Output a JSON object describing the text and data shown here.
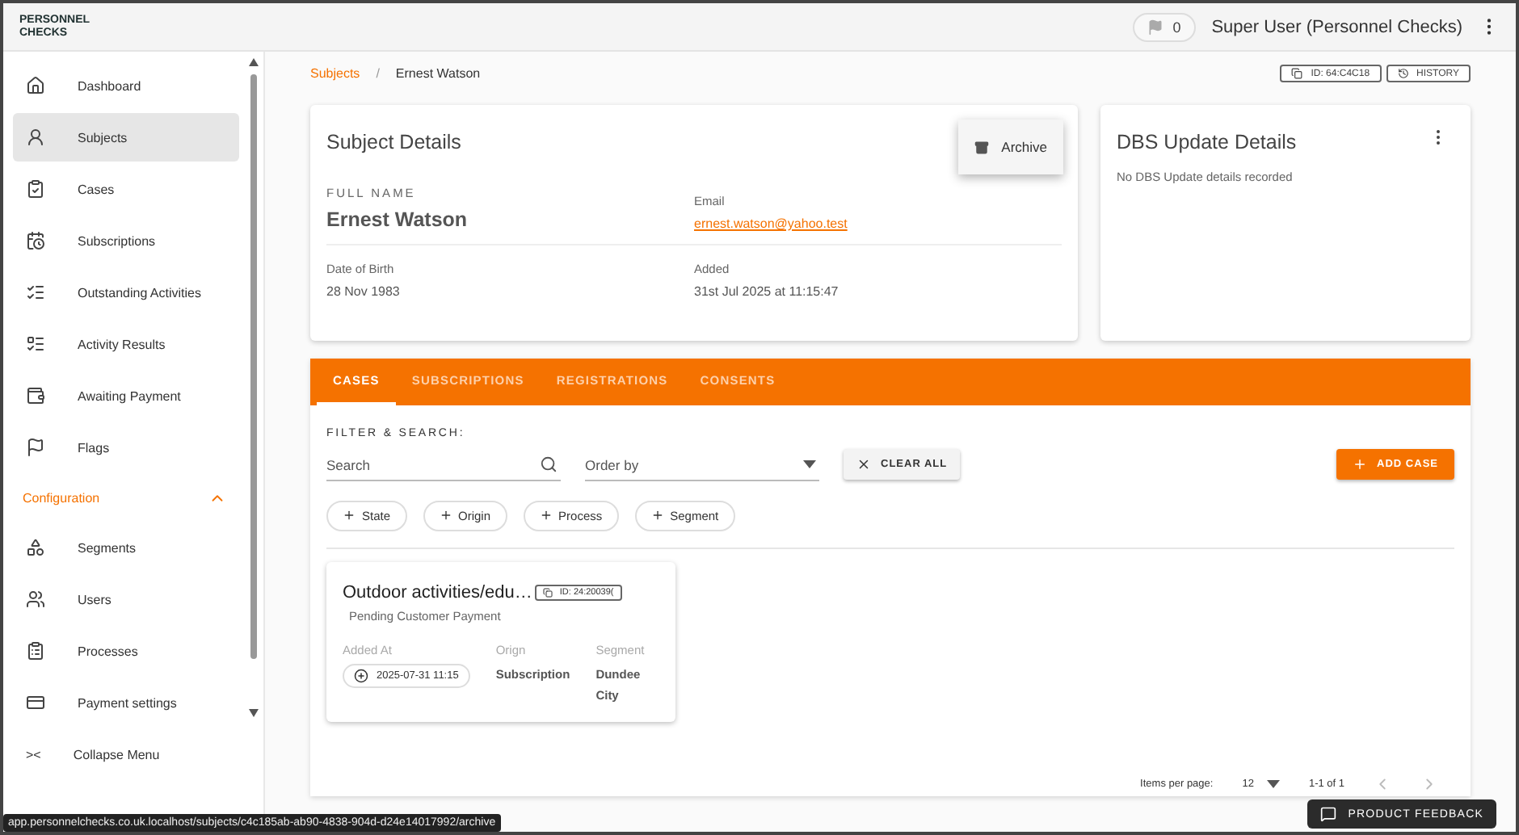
{
  "header": {
    "logo": [
      "PERSONNEL",
      "CHECKS"
    ],
    "flag_count": "0",
    "user": "Super User (Personnel Checks)"
  },
  "sidebar": {
    "items": [
      {
        "label": "Dashboard",
        "selected": false
      },
      {
        "label": "Subjects",
        "selected": true
      },
      {
        "label": "Cases",
        "selected": false
      },
      {
        "label": "Subscriptions",
        "selected": false
      },
      {
        "label": "Outstanding Activities",
        "selected": false
      },
      {
        "label": "Activity Results",
        "selected": false
      },
      {
        "label": "Awaiting Payment",
        "selected": false
      },
      {
        "label": "Flags",
        "selected": false
      }
    ],
    "section": {
      "label": "Configuration",
      "expanded": true
    },
    "config_items": [
      {
        "label": "Segments",
        "selected": false
      },
      {
        "label": "Users",
        "selected": false
      },
      {
        "label": "Processes",
        "selected": false
      },
      {
        "label": "Payment settings",
        "selected": false
      }
    ],
    "collapse": {
      "icon": "><",
      "label": "Collapse Menu"
    }
  },
  "breadcrumb": {
    "items": [
      "Subjects",
      "Ernest Watson"
    ],
    "separator": "/"
  },
  "top_actions": [
    {
      "label": "ID: 64:C4C18"
    },
    {
      "label": "HISTORY"
    }
  ],
  "subject_details": {
    "title": "Subject Details",
    "menu": [
      {
        "label": "Archive"
      }
    ],
    "fields": [
      {
        "label": "FULL NAME",
        "value": "Ernest Watson",
        "kind": "name"
      },
      {
        "label": "Email",
        "value": "ernest.watson@yahoo.test",
        "kind": "link"
      },
      {
        "label": "Date of Birth",
        "value": "28 Nov 1983",
        "kind": "plain"
      },
      {
        "label": "Added",
        "value": "31st Jul 2025 at 11:15:47",
        "kind": "plain"
      }
    ]
  },
  "dbs": {
    "title": "DBS Update Details",
    "message": "No DBS Update details recorded"
  },
  "tabs": [
    {
      "label": "CASES",
      "selected": true
    },
    {
      "label": "SUBSCRIPTIONS",
      "selected": false
    },
    {
      "label": "REGISTRATIONS",
      "selected": false
    },
    {
      "label": "CONSENTS",
      "selected": false
    }
  ],
  "filter": {
    "title": "FILTER & SEARCH:",
    "search": {
      "placeholder": "Search"
    },
    "order": {
      "placeholder": "Order by"
    },
    "clear": "CLEAR ALL",
    "add": "ADD CASE",
    "chips": [
      "State",
      "Origin",
      "Process",
      "Segment"
    ]
  },
  "cases": [
    {
      "title": "Outdoor activities/edu…",
      "id": "ID: 24:20039(",
      "status": "Pending Customer Payment",
      "added_label": "Added At",
      "added": "2025-07-31 11:15",
      "origin_label": "Orign",
      "origin": "Subscription",
      "segment_label": "Segment",
      "segment": "Dundee City"
    }
  ],
  "pagination": {
    "label": "Items per page:",
    "per_page": "12",
    "range": "1-1 of 1"
  },
  "status_url": "app.personnelchecks.co.uk.localhost/subjects/c4c185ab-ab90-4838-904d-d24e14017992/archive",
  "feedback": "PRODUCT FEEDBACK"
}
